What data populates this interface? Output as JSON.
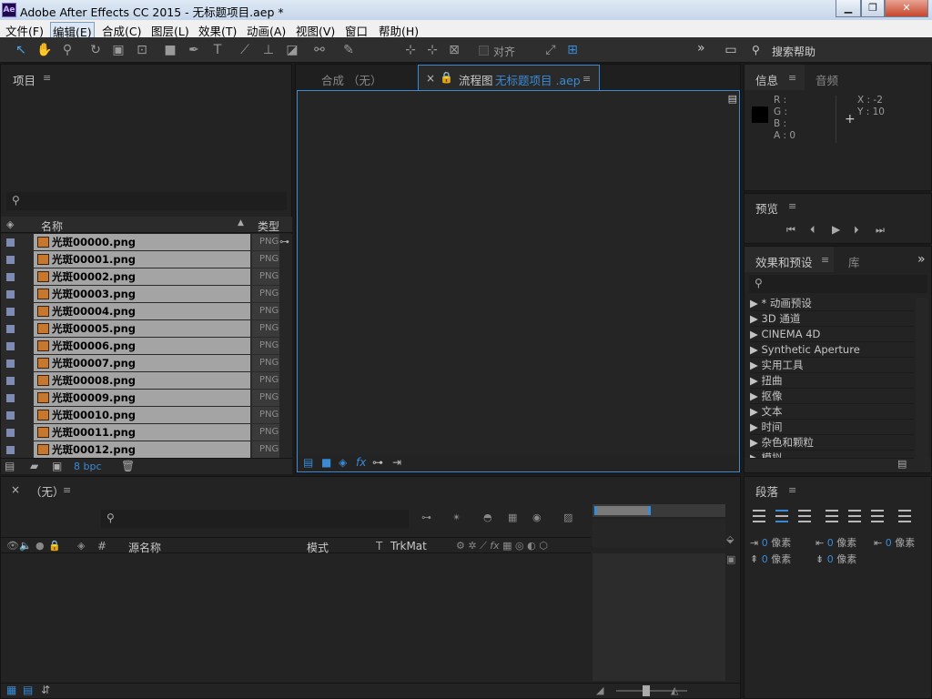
{
  "window": {
    "title": "Adobe After Effects CC 2015 - 无标题项目.aep *",
    "app_icon": "Ae",
    "minimize": "▁",
    "restore": "❐",
    "close": "✕"
  },
  "menu": [
    "文件(F)",
    "编辑(E)",
    "合成(C)",
    "图层(L)",
    "效果(T)",
    "动画(A)",
    "视图(V)",
    "窗口",
    "帮助(H)"
  ],
  "toolbar": {
    "snap_label": "对齐",
    "search_help": "搜索帮助",
    "more": "»"
  },
  "project": {
    "title": "项目",
    "col_name": "名称",
    "col_type": "类型",
    "bpc": "8 bpc",
    "items": [
      {
        "name": "光斑00000.png",
        "type": "PNG"
      },
      {
        "name": "光斑00001.png",
        "type": "PNG"
      },
      {
        "name": "光斑00002.png",
        "type": "PNG"
      },
      {
        "name": "光斑00003.png",
        "type": "PNG"
      },
      {
        "name": "光斑00004.png",
        "type": "PNG"
      },
      {
        "name": "光斑00005.png",
        "type": "PNG"
      },
      {
        "name": "光斑00006.png",
        "type": "PNG"
      },
      {
        "name": "光斑00007.png",
        "type": "PNG"
      },
      {
        "name": "光斑00008.png",
        "type": "PNG"
      },
      {
        "name": "光斑00009.png",
        "type": "PNG"
      },
      {
        "name": "光斑00010.png",
        "type": "PNG"
      },
      {
        "name": "光斑00011.png",
        "type": "PNG"
      },
      {
        "name": "光斑00012.png",
        "type": "PNG"
      }
    ]
  },
  "viewer": {
    "tab_comp": "合成 （无）",
    "tab_flow": "流程图",
    "tab_flow_project": "无标题项目 .aep",
    "close": "×"
  },
  "info": {
    "title": "信息",
    "audio_tab": "音频",
    "r": "R :",
    "g": "G :",
    "b": "B :",
    "a": "A : 0",
    "x": "X : -2",
    "y": "Y : 10"
  },
  "preview": {
    "title": "预览"
  },
  "effects": {
    "title": "效果和预设",
    "library_tab": "库",
    "items": [
      "▶ * 动画预设",
      "▶ 3D 通道",
      "▶ CINEMA 4D",
      "▶ Synthetic Aperture",
      "▶ 实用工具",
      "▶ 扭曲",
      "▶ 抠像",
      "▶ 文本",
      "▶ 时间",
      "▶ 杂色和颗粒",
      "▶ 模拟"
    ]
  },
  "timeline": {
    "close": "×",
    "title": "（无）",
    "col_source": "源名称",
    "col_mode": "模式",
    "col_t": "T",
    "col_trkmat": "TrkMat",
    "col_hash": "#"
  },
  "paragraph": {
    "title": "段落",
    "unit": "像素",
    "values": [
      "0",
      "0",
      "0",
      "0",
      "0"
    ]
  }
}
